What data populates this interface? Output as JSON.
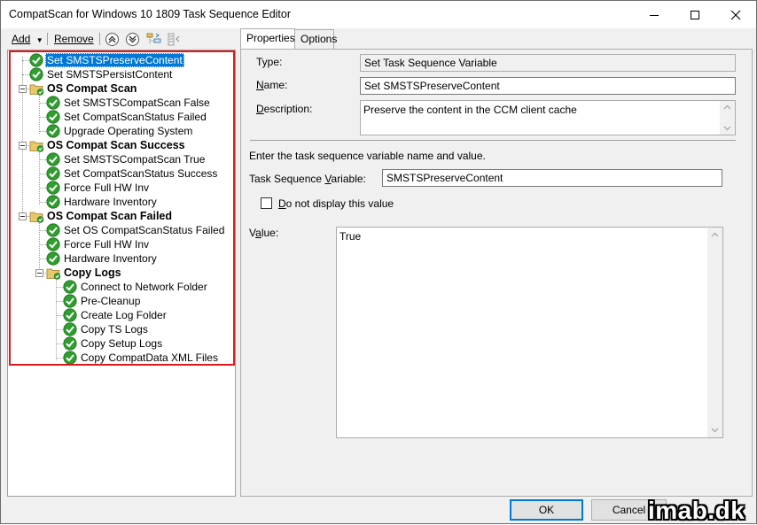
{
  "window": {
    "title": "CompatScan for Windows 10 1809 Task Sequence Editor"
  },
  "toolbar": {
    "add_label": "Add",
    "remove_label": "Remove"
  },
  "tree": [
    {
      "label": "Set SMSTSPreserveContent",
      "type": "step",
      "depth": 0,
      "selected": true
    },
    {
      "label": "Set SMSTSPersistContent",
      "type": "step",
      "depth": 0
    },
    {
      "label": "OS Compat Scan",
      "type": "group",
      "depth": 0
    },
    {
      "label": "Set SMSTSCompatScan False",
      "type": "step",
      "depth": 1
    },
    {
      "label": "Set CompatScanStatus Failed",
      "type": "step",
      "depth": 1
    },
    {
      "label": "Upgrade Operating System",
      "type": "step",
      "depth": 1
    },
    {
      "label": "OS Compat Scan Success",
      "type": "group",
      "depth": 0
    },
    {
      "label": "Set SMSTSCompatScan True",
      "type": "step",
      "depth": 1
    },
    {
      "label": "Set CompatScanStatus Success",
      "type": "step",
      "depth": 1
    },
    {
      "label": "Force Full HW Inv",
      "type": "step",
      "depth": 1
    },
    {
      "label": "Hardware Inventory",
      "type": "step",
      "depth": 1
    },
    {
      "label": "OS Compat Scan Failed",
      "type": "group",
      "depth": 0
    },
    {
      "label": "Set OS CompatScanStatus Failed",
      "type": "step",
      "depth": 1
    },
    {
      "label": "Force Full HW Inv",
      "type": "step",
      "depth": 1
    },
    {
      "label": "Hardware Inventory",
      "type": "step",
      "depth": 1
    },
    {
      "label": "Copy Logs",
      "type": "group",
      "depth": 1
    },
    {
      "label": "Connect to Network Folder",
      "type": "step",
      "depth": 2
    },
    {
      "label": "Pre-Cleanup",
      "type": "step",
      "depth": 2
    },
    {
      "label": "Create Log Folder",
      "type": "step",
      "depth": 2
    },
    {
      "label": "Copy TS Logs",
      "type": "step",
      "depth": 2
    },
    {
      "label": "Copy Setup Logs",
      "type": "step",
      "depth": 2
    },
    {
      "label": "Copy CompatData XML Files",
      "type": "step",
      "depth": 2
    }
  ],
  "tabs": [
    {
      "label": "Properties",
      "active": true
    },
    {
      "label": "Options",
      "active": false
    }
  ],
  "properties": {
    "type_label": "Type:",
    "type_value": "Set Task Sequence Variable",
    "name_label": "Name:",
    "name_value": "Set SMSTSPreserveContent",
    "description_label": "Description:",
    "description_value": "Preserve the content in the CCM client cache",
    "instructions": "Enter the task sequence variable name and value.",
    "variable_label": "Task Sequence Variable:",
    "variable_value": "SMSTSPreserveContent",
    "hide_value_label": "Do not display this value",
    "hide_value_checked": false,
    "value_label": "Value:",
    "value_value": "True"
  },
  "buttons": {
    "ok_label": "OK",
    "cancel_label": "Cancel"
  },
  "watermark": "imab.dk",
  "colors": {
    "selection": "#0078d7",
    "highlight_border": "#e0181b",
    "check_green": "#2e9e2e"
  }
}
